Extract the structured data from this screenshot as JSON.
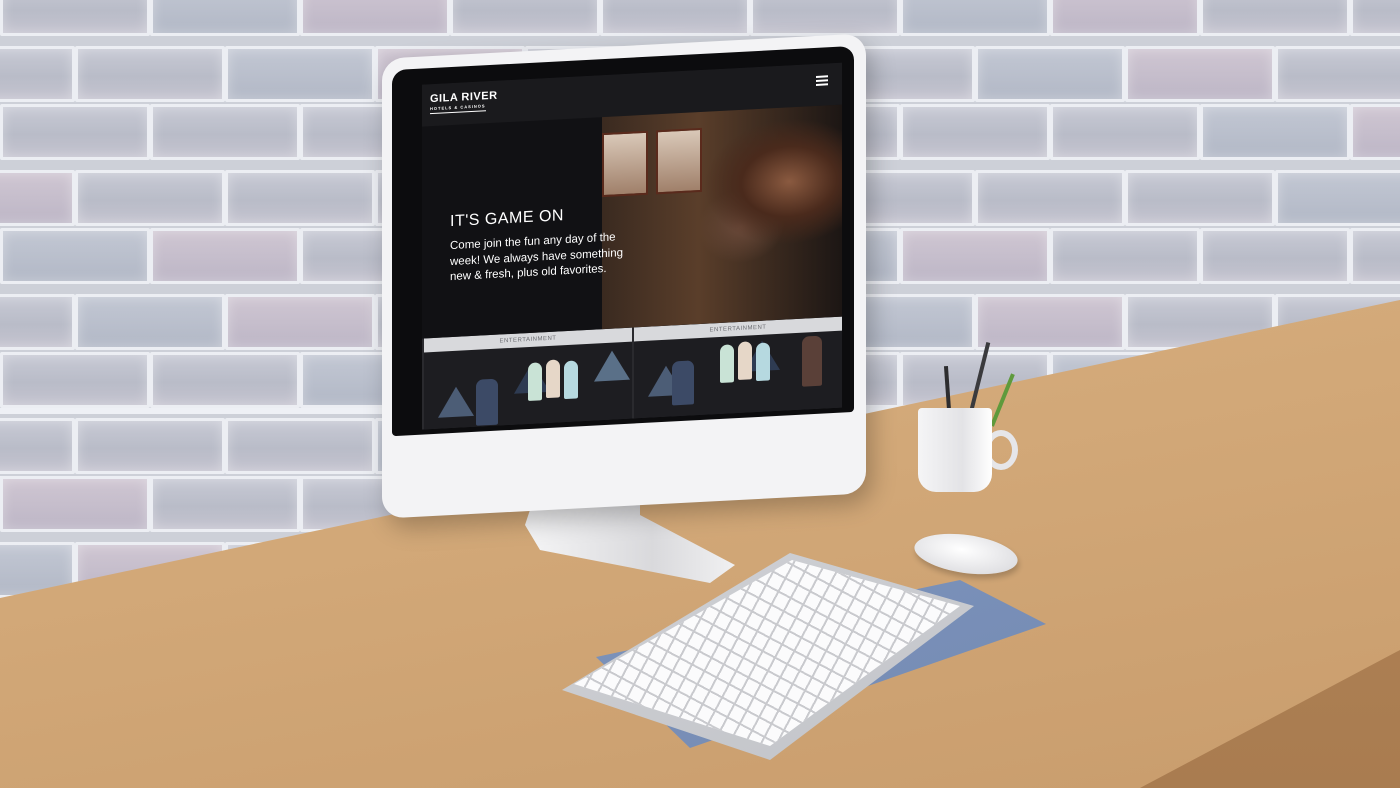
{
  "site": {
    "logo": {
      "name": "GILA RIVER",
      "subtitle": "HOTELS & CASINOS"
    },
    "hero": {
      "title": "IT'S GAME ON",
      "text": "Come join the fun any day of the week! We always have something new & fresh, plus old favorites."
    },
    "cards": [
      {
        "label": "ENTERTAINMENT"
      },
      {
        "label": "ENTERTAINMENT"
      }
    ]
  },
  "colors": {
    "screen_bg": "#111114",
    "accent_blue": "#4c5d76",
    "desk": "#d6ad7d",
    "notebook": "#7f95bd"
  },
  "icons": [
    "menu-icon"
  ]
}
